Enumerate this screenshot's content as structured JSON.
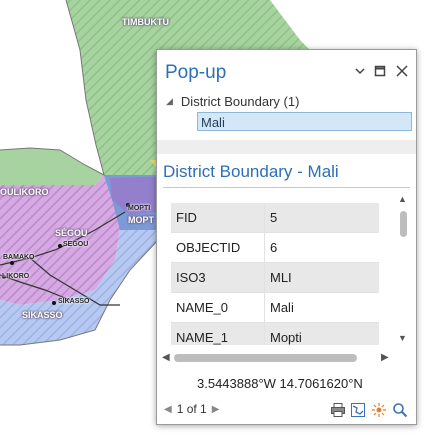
{
  "map": {
    "labels": {
      "timbuktu": "TIMBUKTU",
      "koulikoro": "OULIKORO",
      "segou_region": "SÉGOU",
      "segou_city": "SEGOU",
      "bamako": "BAMAKO",
      "koulikoro_city": "LIKORO",
      "mopti_city": "MOPTI",
      "mopti_region": "MOPT",
      "sikasso_city": "SIKASSO",
      "sikasso_region": "SIKASSO"
    }
  },
  "popup": {
    "title": "Pop-up",
    "layer_tree_label": "District Boundary (1)",
    "selected_feature": "Mali",
    "feature_title": "District Boundary - Mali",
    "fields": [
      {
        "key": "FID",
        "value": "5"
      },
      {
        "key": "OBJECTID",
        "value": "6"
      },
      {
        "key": "ISO3",
        "value": "MLI"
      },
      {
        "key": "NAME_0",
        "value": "Mali"
      },
      {
        "key": "NAME_1",
        "value": "Mopti"
      }
    ],
    "coordinates": "3.5443888°W 14.7061620°N",
    "pager": "1 of 1",
    "icons": {
      "minimize": "chevron-down-icon",
      "maximize": "maximize-icon",
      "close": "close-icon",
      "print": "printer-icon",
      "zoom_to": "zoom-to-icon",
      "flash": "flash-icon",
      "pan_to": "magnifier-icon"
    }
  }
}
